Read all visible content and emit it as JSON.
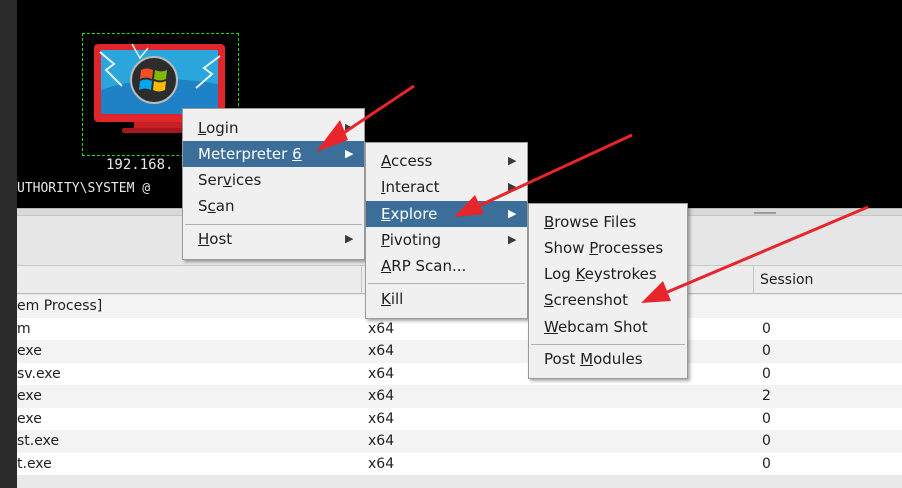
{
  "host": {
    "ip_label": "192.168.",
    "user_label": "UTHORITY\\SYSTEM @"
  },
  "table": {
    "headers": {
      "arch": "",
      "session": "Session"
    },
    "rows": [
      {
        "name": "em Process]",
        "arch": "",
        "session": ""
      },
      {
        "name": "m",
        "arch": "x64",
        "session": "0"
      },
      {
        "name": "exe",
        "arch": "x64",
        "session": "0"
      },
      {
        "name": "sv.exe",
        "arch": "x64",
        "session": "0"
      },
      {
        "name": "exe",
        "arch": "x64",
        "session": "2"
      },
      {
        "name": "exe",
        "arch": "x64",
        "session": "0"
      },
      {
        "name": "st.exe",
        "arch": "x64",
        "session": "0"
      },
      {
        "name": "t.exe",
        "arch": "x64",
        "session": "0"
      }
    ]
  },
  "menu1": {
    "login": {
      "pre": "",
      "u": "L",
      "post": "ogin"
    },
    "meterpreter": {
      "pre": "Meterpreter ",
      "u": "6",
      "post": ""
    },
    "services": {
      "pre": "Ser",
      "u": "v",
      "post": "ices"
    },
    "scan": {
      "pre": "S",
      "u": "c",
      "post": "an"
    },
    "host": {
      "pre": "",
      "u": "H",
      "post": "ost"
    }
  },
  "menu2": {
    "access": {
      "pre": "",
      "u": "A",
      "post": "ccess"
    },
    "interact": {
      "pre": "",
      "u": "I",
      "post": "nteract"
    },
    "explore": {
      "pre": "",
      "u": "E",
      "post": "xplore"
    },
    "pivoting": {
      "pre": "",
      "u": "P",
      "post": "ivoting"
    },
    "arp": {
      "pre": "",
      "u": "A",
      "post": "RP Scan..."
    },
    "kill": {
      "pre": "",
      "u": "K",
      "post": "ill"
    }
  },
  "menu3": {
    "browse": {
      "pre": "",
      "u": "B",
      "post": "rowse Files"
    },
    "processes": {
      "pre": "Show ",
      "u": "P",
      "post": "rocesses"
    },
    "keystrokes": {
      "pre": "Log ",
      "u": "K",
      "post": "eystrokes"
    },
    "screenshot": {
      "pre": "",
      "u": "S",
      "post": "creenshot"
    },
    "webcam": {
      "pre": "",
      "u": "W",
      "post": "ebcam Shot"
    },
    "modules": {
      "pre": "Post ",
      "u": "M",
      "post": "odules"
    }
  },
  "colors": {
    "menu_selected": "#3b6e98",
    "annotation_arrow": "#e8252b",
    "host_selection": "#1ddd1d"
  },
  "icons": {
    "submenu": "triangle-right",
    "host": "windows-monitor-compromised"
  }
}
